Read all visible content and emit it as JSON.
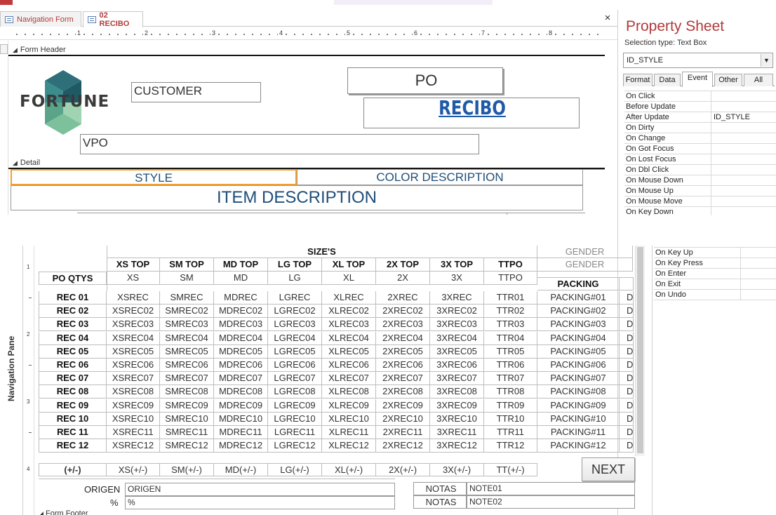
{
  "tabs": [
    {
      "label": "Navigation Form"
    },
    {
      "label": "02 RECIBO"
    }
  ],
  "close_glyph": "×",
  "ruler": [
    "1",
    "2",
    "3",
    "4",
    "5",
    "6",
    "7",
    "8"
  ],
  "sections": {
    "form_header": "Form Header",
    "detail": "Detail",
    "form_footer": "Form Footer"
  },
  "logo": {
    "text": "FORTUNE",
    "colors": [
      "#2e6f7a",
      "#5aa48a",
      "#9fd3b1",
      "#3b8c8c"
    ]
  },
  "header": {
    "customer": "CUSTOMER",
    "po": "PO",
    "recibo": "RECIBO",
    "vpo": "VPO"
  },
  "detail": {
    "style": "STYLE",
    "color_description": "COLOR DESCRIPTION",
    "item_description": "ITEM DESCRIPTION"
  },
  "property_sheet": {
    "title": "Property Sheet",
    "selection_type": "Selection type:  Text Box",
    "selected_control": "ID_STYLE",
    "tabs": [
      "Format",
      "Data",
      "Event",
      "Other",
      "All"
    ],
    "active_tab": "Event",
    "rows_top": [
      {
        "name": "On Click",
        "value": ""
      },
      {
        "name": "Before Update",
        "value": ""
      },
      {
        "name": "After Update",
        "value": "ID_STYLE"
      },
      {
        "name": "On Dirty",
        "value": ""
      },
      {
        "name": "On Change",
        "value": ""
      },
      {
        "name": "On Got Focus",
        "value": ""
      },
      {
        "name": "On Lost Focus",
        "value": ""
      },
      {
        "name": "On Dbl Click",
        "value": ""
      },
      {
        "name": "On Mouse Down",
        "value": ""
      },
      {
        "name": "On Mouse Up",
        "value": ""
      },
      {
        "name": "On Mouse Move",
        "value": ""
      },
      {
        "name": "On Key Down",
        "value": ""
      }
    ],
    "rows_bottom": [
      {
        "name": "On Key Up",
        "value": ""
      },
      {
        "name": "On Key Press",
        "value": ""
      },
      {
        "name": "On Enter",
        "value": ""
      },
      {
        "name": "On Exit",
        "value": ""
      },
      {
        "name": "On Undo",
        "value": ""
      }
    ]
  },
  "nav_pane_label": "Navigation Pane",
  "vertical_ruler": [
    "1",
    "2",
    "3",
    "4"
  ],
  "grid": {
    "sizes_header": "SIZE'S",
    "gender_1": "GENDER",
    "gender_2": "GENDER",
    "packing_header": "PACKING",
    "size_headers": [
      "XS TOP",
      "SM TOP",
      "MD TOP",
      "LG TOP",
      "XL TOP",
      "2X TOP",
      "3X TOP",
      "TTPO"
    ],
    "po_qtys_label": "PO QTYS",
    "po_qtys": [
      "XS",
      "SM",
      "MD",
      "LG",
      "XL",
      "2X",
      "3X",
      "TTPO"
    ],
    "rows": [
      {
        "label": "REC 01",
        "cells": [
          "XSREC",
          "SMREC",
          "MDREC",
          "LGREC",
          "XLREC",
          "2XREC",
          "3XREC",
          "TTR01"
        ],
        "packing": "PACKING#01",
        "extra": "D"
      },
      {
        "label": "REC 02",
        "cells": [
          "XSREC02",
          "SMREC02",
          "MDREC02",
          "LGREC02",
          "XLREC02",
          "2XREC02",
          "3XREC02",
          "TTR02"
        ],
        "packing": "PACKING#02",
        "extra": "D"
      },
      {
        "label": "REC 03",
        "cells": [
          "XSREC03",
          "SMREC03",
          "MDREC03",
          "LGREC03",
          "XLREC03",
          "2XREC03",
          "3XREC03",
          "TTR03"
        ],
        "packing": "PACKING#03",
        "extra": "D"
      },
      {
        "label": "REC 04",
        "cells": [
          "XSREC04",
          "SMREC04",
          "MDREC04",
          "LGREC04",
          "XLREC04",
          "2XREC04",
          "3XREC04",
          "TTR04"
        ],
        "packing": "PACKING#04",
        "extra": "D"
      },
      {
        "label": "REC 05",
        "cells": [
          "XSREC05",
          "SMREC05",
          "MDREC05",
          "LGREC05",
          "XLREC05",
          "2XREC05",
          "3XREC05",
          "TTR05"
        ],
        "packing": "PACKING#05",
        "extra": "D"
      },
      {
        "label": "REC 06",
        "cells": [
          "XSREC06",
          "SMREC06",
          "MDREC06",
          "LGREC06",
          "XLREC06",
          "2XREC06",
          "3XREC06",
          "TTR06"
        ],
        "packing": "PACKING#06",
        "extra": "D"
      },
      {
        "label": "REC 07",
        "cells": [
          "XSREC07",
          "SMREC07",
          "MDREC07",
          "LGREC07",
          "XLREC07",
          "2XREC07",
          "3XREC07",
          "TTR07"
        ],
        "packing": "PACKING#07",
        "extra": "D"
      },
      {
        "label": "REC 08",
        "cells": [
          "XSREC08",
          "SMREC08",
          "MDREC08",
          "LGREC08",
          "XLREC08",
          "2XREC08",
          "3XREC08",
          "TTR08"
        ],
        "packing": "PACKING#08",
        "extra": "D"
      },
      {
        "label": "REC 09",
        "cells": [
          "XSREC09",
          "SMREC09",
          "MDREC09",
          "LGREC09",
          "XLREC09",
          "2XREC09",
          "3XREC09",
          "TTR09"
        ],
        "packing": "PACKING#09",
        "extra": "D"
      },
      {
        "label": "REC 10",
        "cells": [
          "XSREC10",
          "SMREC10",
          "MDREC10",
          "LGREC10",
          "XLREC10",
          "2XREC10",
          "3XREC10",
          "TTR10"
        ],
        "packing": "PACKING#10",
        "extra": "D"
      },
      {
        "label": "REC 11",
        "cells": [
          "XSREC11",
          "SMREC11",
          "MDREC11",
          "LGREC11",
          "XLREC11",
          "2XREC11",
          "3XREC11",
          "TTR11"
        ],
        "packing": "PACKING#11",
        "extra": "D"
      },
      {
        "label": "REC 12",
        "cells": [
          "XSREC12",
          "SMREC12",
          "MDREC12",
          "LGREC12",
          "XLREC12",
          "2XREC12",
          "3XREC12",
          "TTR12"
        ],
        "packing": "PACKING#12",
        "extra": "D"
      }
    ]
  },
  "plus_minus": [
    "(+/-)",
    "XS(+/-)",
    "SM(+/-)",
    "MD(+/-)",
    "LG(+/-)",
    "XL(+/-)",
    "2X(+/-)",
    "3X(+/-)",
    "TT(+/-)"
  ],
  "next_button": "NEXT",
  "origen": {
    "label": "ORIGEN",
    "value": "ORIGEN",
    "pct_label": "%",
    "pct_value": "%"
  },
  "notas": [
    {
      "label": "NOTAS",
      "value": "NOTE01"
    },
    {
      "label": "NOTAS",
      "value": "NOTE02"
    }
  ],
  "colors": {
    "accent": "#b23a3a",
    "focus": "#f0a030",
    "label_blue": "#1f4e79",
    "recibo_blue": "#1f5aa6"
  }
}
